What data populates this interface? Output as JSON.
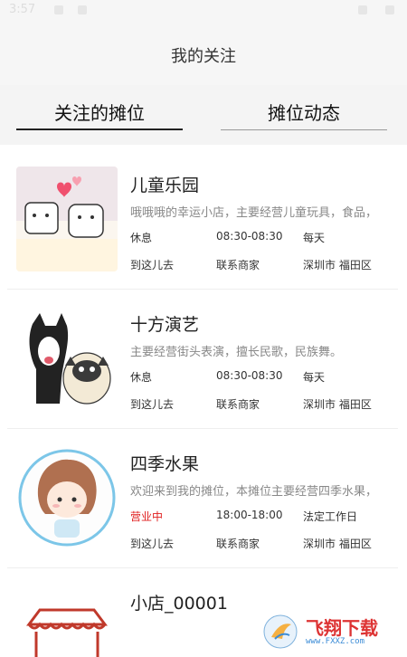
{
  "status_bar": {
    "time": "3:57"
  },
  "header": {
    "title": "我的关注"
  },
  "tabs": [
    {
      "label": "关注的摊位"
    },
    {
      "label": "摊位动态"
    }
  ],
  "actions": {
    "navigate": "到这儿去",
    "contact": "联系商家"
  },
  "stalls": [
    {
      "name": "儿童乐园",
      "description": "哦哦哦的幸运小店，主要经营儿童玩具，食品，",
      "status": "休息",
      "hours": "08:30-08:30",
      "days": "每天",
      "location": "深圳市 福田区",
      "thumbnail": "cartoon-cubes"
    },
    {
      "name": "十方演艺",
      "description": "主要经营街头表演，擅长民歌，民族舞。",
      "status": "休息",
      "hours": "08:30-08:30",
      "days": "每天",
      "location": "深圳市 福田区",
      "thumbnail": "cartoon-dogs"
    },
    {
      "name": "四季水果",
      "description": "欢迎来到我的摊位，本摊位主要经营四季水果，",
      "status": "营业中",
      "hours": "18:00-18:00",
      "days": "法定工作日",
      "location": "深圳市 福田区",
      "thumbnail": "cartoon-girl"
    },
    {
      "name": "小店_00001",
      "thumbnail": "awning-shop"
    }
  ],
  "watermark": {
    "text": "飞翔下载",
    "url": "www.FXXZ.com"
  },
  "colors": {
    "open_status": "#e02020",
    "muted_text": "#888888",
    "header_bg": "#f6f6f6"
  }
}
